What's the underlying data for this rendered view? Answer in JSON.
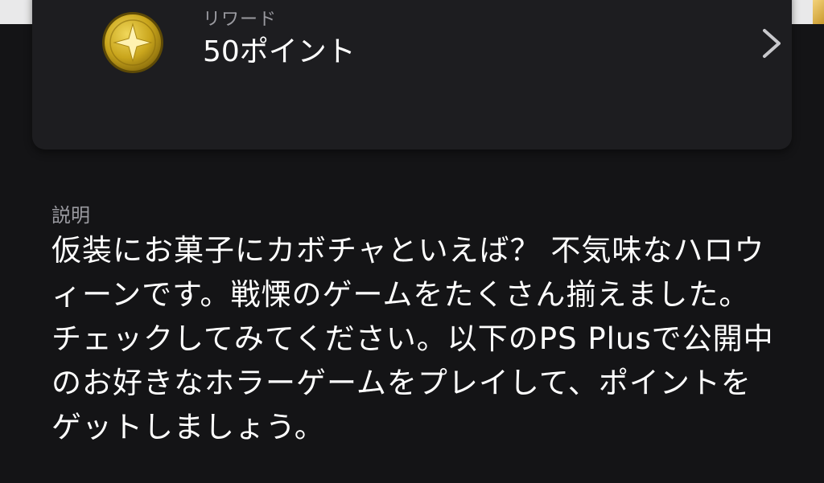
{
  "reward": {
    "label": "リワード",
    "value": "50ポイント",
    "icon": "star-coin-icon",
    "icon_color": "#c9a51c"
  },
  "description": {
    "label": "説明",
    "body": "仮装にお菓子にカボチャといえば？ 不気味なハロウィーンです。戦慄のゲームをたくさん揃えました。チェックしてみてください。以下のPS Plusで公開中のお好きなホラーゲームをプレイして、ポイントをゲットしましょう。"
  },
  "colors": {
    "background": "#141416",
    "card": "#1d1d20",
    "secondary_text": "#9a9aa0"
  }
}
